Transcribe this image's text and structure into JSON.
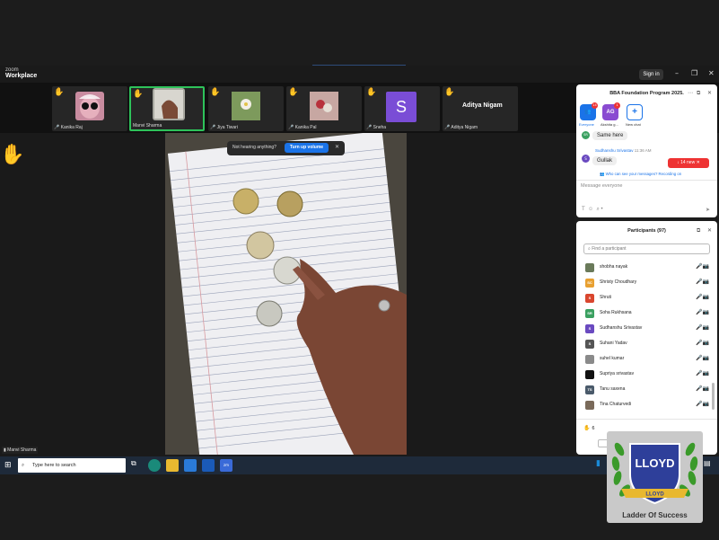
{
  "app": {
    "logo_line1": "zoom",
    "logo_line2": "Workplace",
    "signin_label": "Sign in"
  },
  "participants_strip": [
    {
      "name": "Kanika Raj",
      "type": "image",
      "color": "#c98ca0",
      "raised_hand": true
    },
    {
      "name": "Manvi Sharma",
      "type": "image",
      "color": "#a8a8a0",
      "raised_hand": true,
      "active": true
    },
    {
      "name": "Jiya Tiwari",
      "type": "image",
      "color": "#8aa070",
      "raised_hand": true
    },
    {
      "name": "Kanika Pal",
      "type": "image",
      "color": "#b07a80",
      "raised_hand": true
    },
    {
      "name": "Sneha",
      "type": "initial",
      "initial": "S",
      "color": "#7a4dd6",
      "raised_hand": true
    },
    {
      "name": "Aditya Nigam",
      "type": "name",
      "raised_hand": true
    }
  ],
  "main": {
    "speaker_label": "Manvi Sharma",
    "toast_text": "Not hearing anything?",
    "toast_button": "Turn up volume"
  },
  "chat": {
    "title": "BBA Foundation Program 2025.",
    "tabs": [
      {
        "label": "Everyone",
        "initial": "👥",
        "color": "#1a73e8",
        "badge": "14"
      },
      {
        "label": "Akshita g...",
        "initial": "AG",
        "color": "#8a4bd1",
        "badge": "1"
      },
      {
        "label": "New chat",
        "initial": "+",
        "color": "#ffffff"
      }
    ],
    "message_first": "Same here",
    "sender": "Sudhanshu Srivastav",
    "sender_time": "11:36 AM",
    "message_second": "Gullak",
    "new_count": "14 new",
    "notice": "Who can see your messages? Recording on",
    "input_placeholder": "Message everyone"
  },
  "participants_panel": {
    "title": "Participants (97)",
    "search_placeholder": "Find a participant",
    "items": [
      {
        "name": "shobha nayak",
        "initials": "",
        "color": "#6a7a5a"
      },
      {
        "name": "Shristy Choudhary",
        "initials": "SC",
        "color": "#e8a030"
      },
      {
        "name": "Shruti",
        "initials": "S",
        "color": "#d9462e"
      },
      {
        "name": "Soha Rukhsana",
        "initials": "SR",
        "color": "#3aa060"
      },
      {
        "name": "Sudhanshu Srivastav",
        "initials": "S",
        "color": "#6a4ac0"
      },
      {
        "name": "Suhani Yadav",
        "initials": "S",
        "color": "#555555"
      },
      {
        "name": "suhel kumar",
        "initials": "",
        "color": "#8a8a8a"
      },
      {
        "name": "Supriya srivastav",
        "initials": "",
        "color": "#111111"
      },
      {
        "name": "Tanu saxena",
        "initials": "TS",
        "color": "#4a5a6a"
      },
      {
        "name": "Tina Chaturvedi",
        "initials": "",
        "color": "#7a6a5a"
      }
    ],
    "raised_count": "6"
  },
  "taskbar": {
    "search_placeholder": "Type here to search"
  },
  "watermark": {
    "brand": "LLOYD",
    "ribbon": "LLOYD",
    "tagline": "Ladder Of Success"
  }
}
